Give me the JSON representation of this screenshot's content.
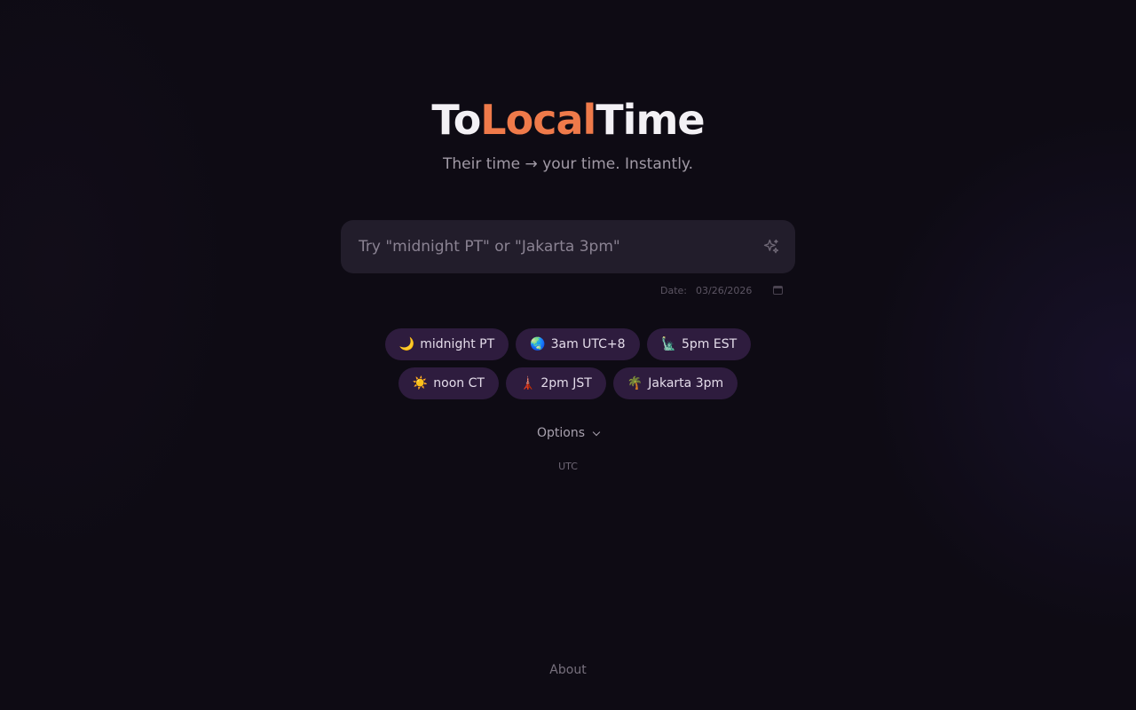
{
  "header": {
    "title_part1": "To",
    "title_part2": "Local",
    "title_part3": "Time",
    "subtitle": "Their time → your time. Instantly."
  },
  "search": {
    "placeholder": "Try \"midnight PT\" or \"Jakarta 3pm\"",
    "value": "",
    "icon": "sparkle-icon"
  },
  "date": {
    "label": "Date:",
    "value": "03/26/2026",
    "icon": "calendar-icon"
  },
  "chips": [
    {
      "emoji": "🌙",
      "label": "midnight PT"
    },
    {
      "emoji": "🌏",
      "label": "3am UTC+8"
    },
    {
      "emoji": "🗽",
      "label": "5pm EST"
    },
    {
      "emoji": "☀️",
      "label": "noon CT"
    },
    {
      "emoji": "🗼",
      "label": "2pm JST"
    },
    {
      "emoji": "🌴",
      "label": "Jakarta 3pm"
    }
  ],
  "options": {
    "label": "Options"
  },
  "timezone": {
    "label": "UTC"
  },
  "footer": {
    "about_label": "About"
  },
  "colors": {
    "background": "#0e0b14",
    "accent": "#ef7a4a",
    "chip_bg": "#2e1c3e",
    "input_bg": "#221d2b"
  }
}
